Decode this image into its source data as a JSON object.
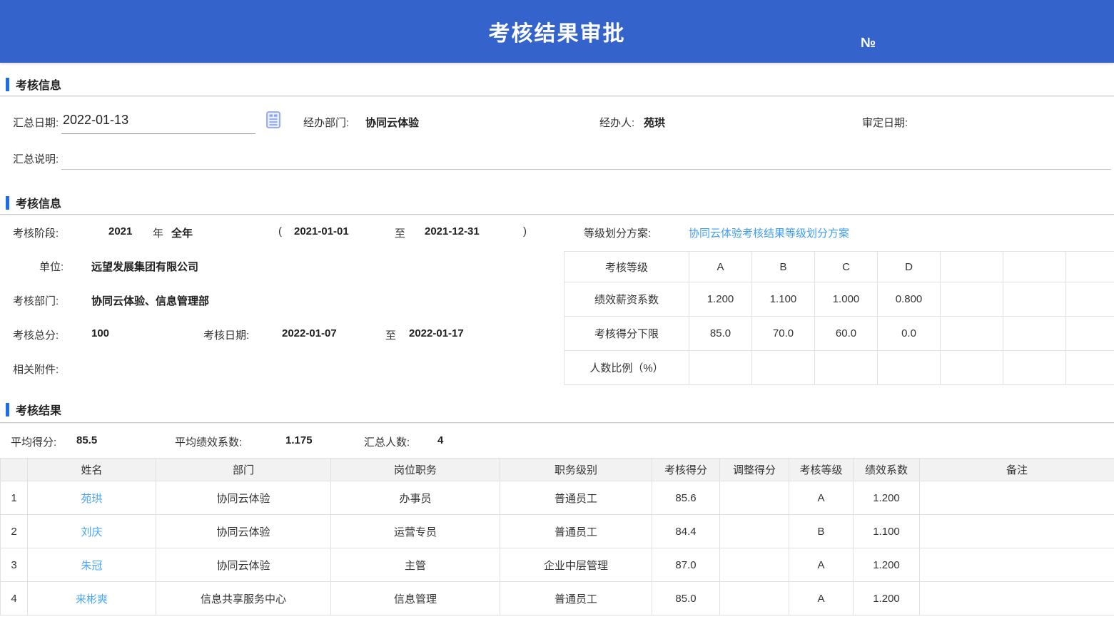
{
  "header": {
    "title": "考核结果审批",
    "number_label": "№"
  },
  "icons": {
    "calendar": "date-picker-calendar-icon"
  },
  "colors": {
    "header_bg": "#3464cb",
    "section_bar": "#1f6ce8",
    "link": "#3e9cf5",
    "table_border": "#e0e0e0",
    "table_header_bg": "#f2f2f2"
  },
  "assessment_info": {
    "title": "考核信息",
    "summary_date": {
      "label": "汇总日期:",
      "value": "2022-01-13"
    },
    "handling_dept": {
      "label": "经办部门:",
      "value": "协同云体验"
    },
    "handler": {
      "label": "经办人:",
      "value": "苑珙"
    },
    "review_date": {
      "label": "审定日期:",
      "value": ""
    },
    "summary_note": {
      "label": "汇总说明:",
      "value": ""
    }
  },
  "assessment_detail": {
    "title": "考核信息",
    "phase": {
      "label": "考核阶段:",
      "year": "2021",
      "year_unit": "年",
      "period": "全年",
      "paren_open": "(",
      "start_date": "2021-01-01",
      "to": "至",
      "end_date": "2021-12-31",
      "paren_close": ")"
    },
    "unit": {
      "label": "单位:",
      "value": "远望发展集团有限公司"
    },
    "dept": {
      "label": "考核部门:",
      "value": "协同云体验、信息管理部"
    },
    "total_score": {
      "label": "考核总分:",
      "value": "100"
    },
    "assess_date": {
      "label": "考核日期:",
      "start": "2022-01-07",
      "to": "至",
      "end": "2022-01-17"
    },
    "attachment": {
      "label": "相关附件:",
      "value": ""
    },
    "grade_scheme": {
      "label": "等级划分方案:",
      "link": "协同云体验考核结果等级划分方案"
    },
    "grade_table": {
      "corner_label": "考核等级",
      "grades": [
        "A",
        "B",
        "C",
        "D",
        "",
        "",
        ""
      ],
      "rows": [
        {
          "label": "绩效薪资系数",
          "values": [
            "1.200",
            "1.100",
            "1.000",
            "0.800",
            "",
            "",
            ""
          ]
        },
        {
          "label": "考核得分下限",
          "values": [
            "85.0",
            "70.0",
            "60.0",
            "0.0",
            "",
            "",
            ""
          ]
        },
        {
          "label": "人数比例（%）",
          "values": [
            "",
            "",
            "",
            "",
            "",
            "",
            ""
          ]
        }
      ]
    }
  },
  "results": {
    "title": "考核结果",
    "avg_score": {
      "label": "平均得分:",
      "value": "85.5"
    },
    "avg_coeff": {
      "label": "平均绩效系数:",
      "value": "1.175"
    },
    "headcount": {
      "label": "汇总人数:",
      "value": "4"
    },
    "columns": [
      "",
      "姓名",
      "部门",
      "岗位职务",
      "职务级别",
      "考核得分",
      "调整得分",
      "考核等级",
      "绩效系数",
      "备注"
    ],
    "rows": [
      {
        "no": "1",
        "name": "苑珙",
        "dept": "协同云体验",
        "position": "办事员",
        "level": "普通员工",
        "score": "85.6",
        "adjusted": "",
        "grade": "A",
        "coeff": "1.200",
        "remark": ""
      },
      {
        "no": "2",
        "name": "刘庆",
        "dept": "协同云体验",
        "position": "运营专员",
        "level": "普通员工",
        "score": "84.4",
        "adjusted": "",
        "grade": "B",
        "coeff": "1.100",
        "remark": ""
      },
      {
        "no": "3",
        "name": "朱冠",
        "dept": "协同云体验",
        "position": "主管",
        "level": "企业中层管理",
        "score": "87.0",
        "adjusted": "",
        "grade": "A",
        "coeff": "1.200",
        "remark": ""
      },
      {
        "no": "4",
        "name": "来彬爽",
        "dept": "信息共享服务中心",
        "position": "信息管理",
        "level": "普通员工",
        "score": "85.0",
        "adjusted": "",
        "grade": "A",
        "coeff": "1.200",
        "remark": ""
      }
    ]
  }
}
